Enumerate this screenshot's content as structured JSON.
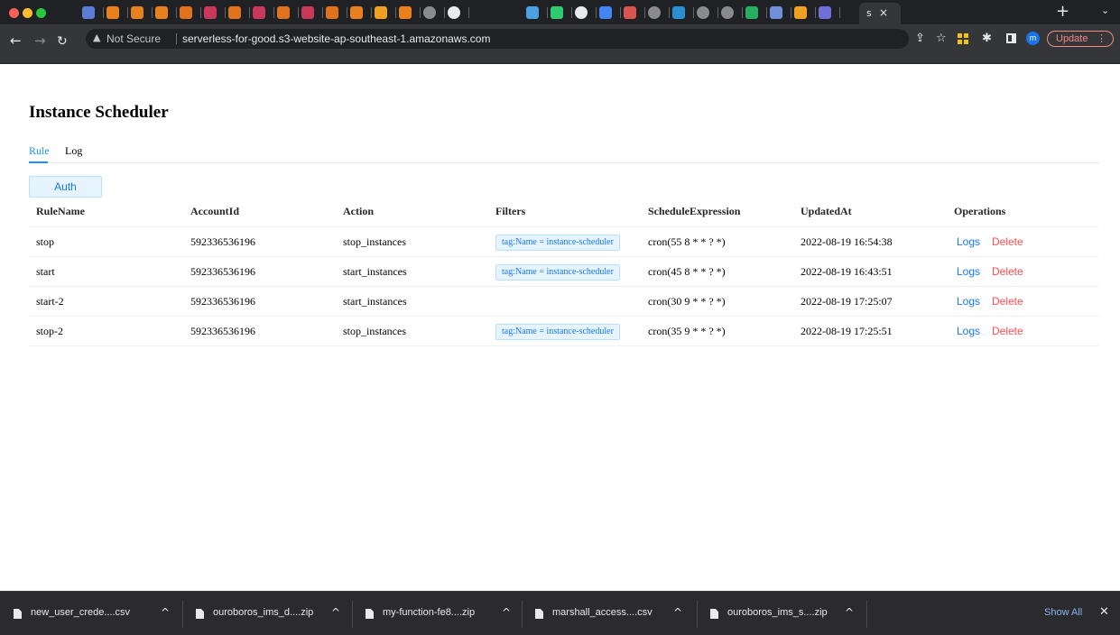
{
  "browser": {
    "active_tab_label": "s",
    "tab_close_glyph": "×",
    "new_tab_glyph": "+",
    "tab_menu_glyph": "⌄",
    "address": {
      "security_label": "Not Secure",
      "url": "serverless-for-good.s3-website-ap-southeast-1.amazonaws.com"
    },
    "avatar_letter": "m",
    "update_label": "Update",
    "favicon_colors": [
      "#5b7bd5",
      "#e8811d",
      "#e8811d",
      "#e8811d",
      "#e2721b",
      "#c8385a",
      "#e2721b",
      "#c8385a",
      "#e2721b",
      "#c8385a",
      "#e2721b",
      "#e8811d",
      "#f0a020",
      "#e8811d",
      "#8a8b8e",
      "#e8eaed",
      "#4aa0e0",
      "#2ecc71",
      "#e8eaed",
      "#4285f4",
      "#d9534f",
      "#8a8b8e",
      "#2a8fd1",
      "#8a8b8e",
      "#8a8b8e",
      "#27ae60",
      "#6f8fd8",
      "#f0a020",
      "#6f6fd8"
    ]
  },
  "page": {
    "title": "Instance Scheduler",
    "tabs": [
      {
        "label": "Rule",
        "active": true
      },
      {
        "label": "Log",
        "active": false
      }
    ],
    "auth_button": "Auth",
    "table": {
      "headers": [
        "RuleName",
        "AccountId",
        "Action",
        "Filters",
        "ScheduleExpression",
        "UpdatedAt",
        "Operations"
      ],
      "rows": [
        {
          "name": "stop",
          "account": "592336536196",
          "action": "stop_instances",
          "filter": "tag:Name = instance-scheduler",
          "schedule": "cron(55 8 * * ? *)",
          "updated": "2022-08-19 16:54:38"
        },
        {
          "name": "start",
          "account": "592336536196",
          "action": "start_instances",
          "filter": "tag:Name = instance-scheduler",
          "schedule": "cron(45 8 * * ? *)",
          "updated": "2022-08-19 16:43:51"
        },
        {
          "name": "start-2",
          "account": "592336536196",
          "action": "start_instances",
          "filter": "",
          "schedule": "cron(30 9 * * ? *)",
          "updated": "2022-08-19 17:25:07"
        },
        {
          "name": "stop-2",
          "account": "592336536196",
          "action": "stop_instances",
          "filter": "tag:Name = instance-scheduler",
          "schedule": "cron(35 9 * * ? *)",
          "updated": "2022-08-19 17:25:51"
        }
      ],
      "op_logs": "Logs",
      "op_delete": "Delete"
    }
  },
  "downloads": {
    "items": [
      {
        "name": "new_user_crede....csv"
      },
      {
        "name": "ouroboros_ims_d....zip"
      },
      {
        "name": "my-function-fe8....zip"
      },
      {
        "name": "marshall_access....csv"
      },
      {
        "name": "ouroboros_ims_s....zip"
      }
    ],
    "caret_glyph": "^",
    "show_all": "Show All",
    "close_glyph": "✕"
  }
}
